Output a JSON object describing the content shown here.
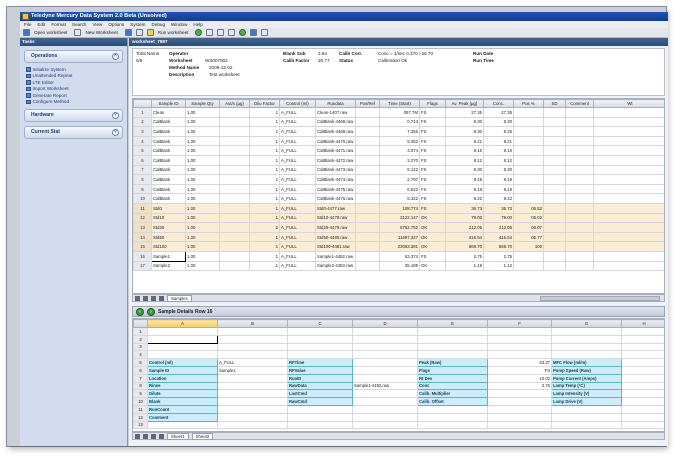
{
  "window": {
    "title": "Teledyne Mercury Data System 2.0 Beta (Unsolved)"
  },
  "menu": [
    "File",
    "Edit",
    "Format",
    "Search",
    "View",
    "Options",
    "System",
    "Debug",
    "Window",
    "Help"
  ],
  "toolbar": {
    "open_worksheet": "Open worksheet",
    "new_worksheet": "New Worksheet",
    "run_worksheet": "Run worksheet"
  },
  "left_pane": {
    "title": "Tasks",
    "operations_title": "Operations",
    "operations": [
      "Initialize System",
      "Unattended Repeat",
      "LTE Editor",
      "Import Worksheet",
      "Generate Report",
      "Configure Method"
    ],
    "hardware_title": "Hardware",
    "current_stat_title": "Current Stat"
  },
  "worksheet": {
    "tab_title": "worksheet_7887",
    "info": {
      "total_name_label": "Total Name",
      "total_name_value": "0/8",
      "operator_label": "Operator",
      "worksheet_label": "Worksheet",
      "worksheet_value": "WS007902",
      "method_name_label": "Method Name",
      "method_name_value": "2009-12-02",
      "description_label": "Description",
      "description_value": "Test worksheet",
      "blank_sub_label": "Blank Sub",
      "blank_sub_value": "3.64",
      "calib_factor_label": "Calib Factor",
      "calib_factor_value": "26.77",
      "calib_corr_label": "Calib Corr.",
      "status_label": "Status",
      "conc_label": "Conc = 1/sec 0.370 / 26.70",
      "calibration_label": "Calibration Ok",
      "run_date_label": "Run Date",
      "run_time_label": "Run Time"
    },
    "columns": [
      "",
      "Sample ID",
      "Sample Qty",
      "Aut/s (µg)",
      "Dilu Factor",
      "Control (ml)",
      "Rundata",
      "Pos/Ref",
      "Time (Start)",
      "Flags",
      "Av. Peak (µg)",
      "Conc.",
      "Pos %",
      "SD",
      "Comment",
      "Wt"
    ],
    "rows": [
      {
        "n": "1",
        "id": "Clean",
        "qty": "1.00",
        "dil": "1",
        "ctl": "A_FULL",
        "file": "Clean-1407.raw",
        "time": "097.7M",
        "flag": "FS",
        "peak": "27.35",
        "conc": "27.35",
        "pos": "",
        "hl": false
      },
      {
        "n": "2",
        "id": "CalBlank",
        "qty": "1.00",
        "dil": "1",
        "ctl": "A_FULL",
        "file": "CalBlank-4468.raw",
        "time": "0.714",
        "flag": "FS",
        "peak": "8.30",
        "conc": "8.30",
        "pos": "",
        "hl": false
      },
      {
        "n": "3",
        "id": "CalBlank",
        "qty": "1.00",
        "dil": "1",
        "ctl": "A_FULL",
        "file": "CalBlank-4469.raw",
        "time": "7.356",
        "flag": "FS",
        "peak": "8.30",
        "conc": "8.25",
        "pos": "",
        "hl": false
      },
      {
        "n": "4",
        "id": "CalBlank",
        "qty": "1.00",
        "dil": "1",
        "ctl": "A_FULL",
        "file": "CalBlank-4470.raw",
        "time": "5.052",
        "flag": "FS",
        "peak": "8.21",
        "conc": "8.21",
        "pos": "",
        "hl": false
      },
      {
        "n": "5",
        "id": "CalBlank",
        "qty": "1.00",
        "dil": "1",
        "ctl": "A_FULL",
        "file": "CalBlank-4471.raw",
        "time": "3.074",
        "flag": "FS",
        "peak": "8.15",
        "conc": "8.15",
        "pos": "",
        "hl": false
      },
      {
        "n": "6",
        "id": "CalBlank",
        "qty": "1.00",
        "dil": "1",
        "ctl": "A_FULL",
        "file": "CalBlank-4472.raw",
        "time": "3.270",
        "flag": "FS",
        "peak": "8.12",
        "conc": "8.12",
        "pos": "",
        "hl": false
      },
      {
        "n": "7",
        "id": "CalBlank",
        "qty": "1.00",
        "dil": "1",
        "ctl": "A_FULL",
        "file": "CalBlank-4473.raw",
        "time": "6.122",
        "flag": "FS",
        "peak": "8.30",
        "conc": "8.30",
        "pos": "",
        "hl": false
      },
      {
        "n": "8",
        "id": "CalBlank",
        "qty": "1.00",
        "dil": "1",
        "ctl": "A_FULL",
        "file": "CalBlank-4474.raw",
        "time": "2.797",
        "flag": "FS",
        "peak": "8.19",
        "conc": "8.19",
        "pos": "",
        "hl": false
      },
      {
        "n": "9",
        "id": "CalBlank",
        "qty": "1.00",
        "dil": "1",
        "ctl": "A_FULL",
        "file": "CalBlank-4475.raw",
        "time": "6.522",
        "flag": "FS",
        "peak": "8.19",
        "conc": "8.19",
        "pos": "",
        "hl": false
      },
      {
        "n": "10",
        "id": "CalBlank",
        "qty": "1.00",
        "dil": "1",
        "ctl": "A_FULL",
        "file": "CalBlank-4476.raw",
        "time": "5.322",
        "flag": "FS",
        "peak": "8.22",
        "conc": "8.22",
        "pos": "",
        "hl": false
      },
      {
        "n": "11",
        "id": "Std0",
        "qty": "1.00",
        "dil": "1",
        "ctl": "A_FULL",
        "file": "Std0-4477.raw",
        "time": "108.774",
        "flag": "FS",
        "peak": "36.73",
        "conc": "36.73",
        "pos": "05.52",
        "hl": true
      },
      {
        "n": "12",
        "id": "Std10",
        "qty": "1.00",
        "dil": "1",
        "ctl": "A_FULL",
        "file": "Std10-4478.raw",
        "time": "2122.147",
        "flag": "OK",
        "peak": "79.00",
        "conc": "79.00",
        "pos": "06.02",
        "hl": true
      },
      {
        "n": "13",
        "id": "Std25",
        "qty": "1.00",
        "dil": "2",
        "ctl": "A_FULL",
        "file": "Std25-4479.raw",
        "time": "5752.752",
        "flag": "OK",
        "peak": "212.05",
        "conc": "212.05",
        "pos": "06.07",
        "hl": true
      },
      {
        "n": "14",
        "id": "Std50",
        "qty": "1.00",
        "dil": "1",
        "ctl": "A_FULL",
        "file": "Std50-4480.raw",
        "time": "11697.347",
        "flag": "OK",
        "peak": "416.54",
        "conc": "416.54",
        "pos": "05.77",
        "hl": true
      },
      {
        "n": "15",
        "id": "Std100",
        "qty": "1.00",
        "dil": "1",
        "ctl": "A_FULL",
        "file": "Std100-4481.raw",
        "time": "23063.381",
        "flag": "OK",
        "peak": "869.70",
        "conc": "869.70",
        "pos": "100",
        "hl": true
      },
      {
        "n": "16",
        "id": "Sample1",
        "qty": "1.00",
        "dil": "1",
        "ctl": "A_FULL",
        "file": "Sample1-4482.raw",
        "time": "63.374",
        "flag": "FS",
        "peak": "2.75",
        "conc": "2.75",
        "pos": "",
        "hl": false
      },
      {
        "n": "17",
        "id": "Sample2",
        "qty": "1.00",
        "dil": "1",
        "ctl": "A_FULL",
        "file": "Sample2-4483.raw",
        "time": "35.185",
        "flag": "OK",
        "peak": "1.19",
        "conc": "1.12",
        "pos": "",
        "hl": false
      }
    ],
    "sheet_tab": "Samples"
  },
  "detail": {
    "title": "Sample Details Row 16",
    "columns": [
      "",
      "A",
      "B",
      "C",
      "D",
      "E",
      "F",
      "G",
      "H"
    ],
    "labels_a": [
      "Control (ml)",
      "Sample ID",
      "Location",
      "Rinse",
      "Dilute",
      "Blank",
      "RunCount",
      "Comment"
    ],
    "values_b": [
      "A_FULL",
      "Sample1",
      "",
      "",
      "",
      "",
      "",
      ""
    ],
    "labels_c": [
      "RFTime",
      "RFValue",
      "RunID",
      "RawData",
      "LastCmd",
      "RawCmd"
    ],
    "value_d_rawdata": "Sample1-4482.raw",
    "value_d_num": "4.00",
    "labels_e": [
      "Peak (Raw)",
      "Flags",
      "Rt Dev",
      "Conc",
      "Calib. Multiplier",
      "Calib. Offset"
    ],
    "values_f": [
      "63.37",
      "FS",
      "10.02",
      "2.75"
    ],
    "value_f_extra": "2.750",
    "labels_g": [
      "MFC Flow (ml/m)",
      "Pump Speed (Raw)",
      "Pump Current (Amps)",
      "Lamp Temp (°C)",
      "Lamp Intensity (V)",
      "Lamp Drive (V)"
    ],
    "sheet_tabs": [
      "Sheet1",
      "Sheet2"
    ]
  }
}
